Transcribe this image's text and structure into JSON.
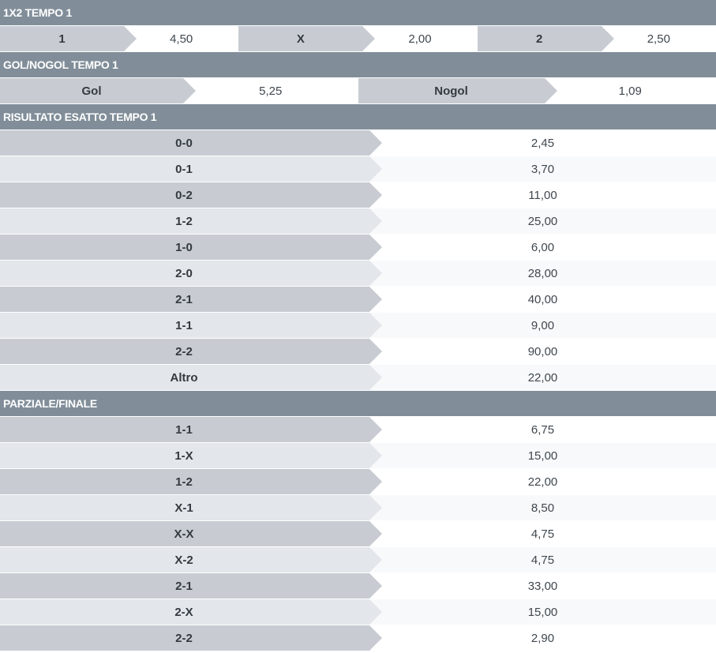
{
  "sections": {
    "x12": {
      "title": "1X2 TEMPO 1",
      "options": [
        {
          "label": "1",
          "odd": "4,50"
        },
        {
          "label": "X",
          "odd": "2,00"
        },
        {
          "label": "2",
          "odd": "2,50"
        }
      ]
    },
    "golnogol": {
      "title": "GOL/NOGOL TEMPO 1",
      "options": [
        {
          "label": "Gol",
          "odd": "5,25"
        },
        {
          "label": "Nogol",
          "odd": "1,09"
        }
      ]
    },
    "risultato": {
      "title": "RISULTATO ESATTO TEMPO 1",
      "rows": [
        {
          "label": "0-0",
          "odd": "2,45"
        },
        {
          "label": "0-1",
          "odd": "3,70"
        },
        {
          "label": "0-2",
          "odd": "11,00"
        },
        {
          "label": "1-2",
          "odd": "25,00"
        },
        {
          "label": "1-0",
          "odd": "6,00"
        },
        {
          "label": "2-0",
          "odd": "28,00"
        },
        {
          "label": "2-1",
          "odd": "40,00"
        },
        {
          "label": "1-1",
          "odd": "9,00"
        },
        {
          "label": "2-2",
          "odd": "90,00"
        },
        {
          "label": "Altro",
          "odd": "22,00"
        }
      ]
    },
    "parziale": {
      "title": "PARZIALE/FINALE",
      "rows": [
        {
          "label": "1-1",
          "odd": "6,75"
        },
        {
          "label": "1-X",
          "odd": "15,00"
        },
        {
          "label": "1-2",
          "odd": "22,00"
        },
        {
          "label": "X-1",
          "odd": "8,50"
        },
        {
          "label": "X-X",
          "odd": "4,75"
        },
        {
          "label": "X-2",
          "odd": "4,75"
        },
        {
          "label": "2-1",
          "odd": "33,00"
        },
        {
          "label": "2-X",
          "odd": "15,00"
        },
        {
          "label": "2-2",
          "odd": "2,90"
        }
      ]
    }
  }
}
